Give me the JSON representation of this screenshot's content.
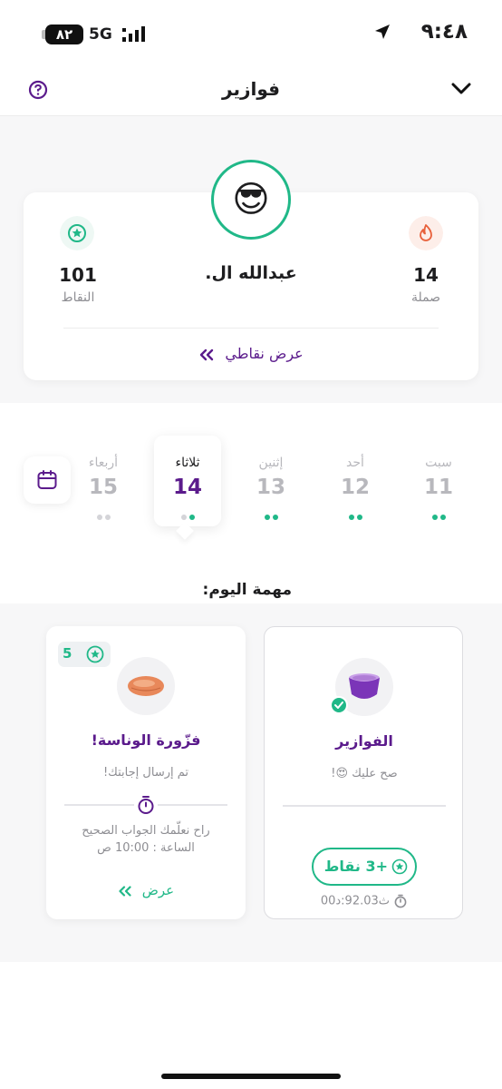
{
  "status_bar": {
    "time": "٩:٤٨",
    "battery": "٨٢",
    "network": "5G"
  },
  "header": {
    "title": "فوازير"
  },
  "profile": {
    "emoji": "😎",
    "name": "عبدالله ال.",
    "points_value": "101",
    "points_label": "النقاط",
    "streak_value": "14",
    "streak_label": "صملة",
    "view_points_label": "عرض نقاطي"
  },
  "days": [
    {
      "name": "سبت",
      "number": "11",
      "dots": [
        "done",
        "done"
      ]
    },
    {
      "name": "أحد",
      "number": "12",
      "dots": [
        "done",
        "done"
      ]
    },
    {
      "name": "إثنين",
      "number": "13",
      "dots": [
        "done",
        "done"
      ]
    },
    {
      "name": "ثلاثاء",
      "number": "14",
      "dots": [
        "empty",
        "done"
      ],
      "active": true
    },
    {
      "name": "أربعاء",
      "number": "15",
      "dots": [
        "empty",
        "empty"
      ]
    }
  ],
  "tasks": {
    "title": "مهمة اليوم:",
    "fawazeer": {
      "name": "الفوازير",
      "status": "صح عليك 😍!",
      "reward": "+3 نقاط",
      "time": "ث92.03:د00"
    },
    "winasa": {
      "name": "فزّورة الوناسة!",
      "status": "تم إرسال إجابتك!",
      "note_line1": "راح نعلّمك الجواب الصحيح",
      "note_line2": "الساعة : 10:00 ص",
      "points": "5",
      "view_label": "عرض"
    }
  },
  "colors": {
    "accent_purple": "#5b1b8c",
    "accent_green": "#20b888",
    "streak_orange": "#e8613c"
  },
  "icons": {
    "help": "question-circle-icon",
    "collapse": "chevron-down-icon",
    "points": "star-badge-icon",
    "streak": "flame-icon",
    "calendar": "calendar-icon",
    "timer": "stopwatch-icon"
  }
}
